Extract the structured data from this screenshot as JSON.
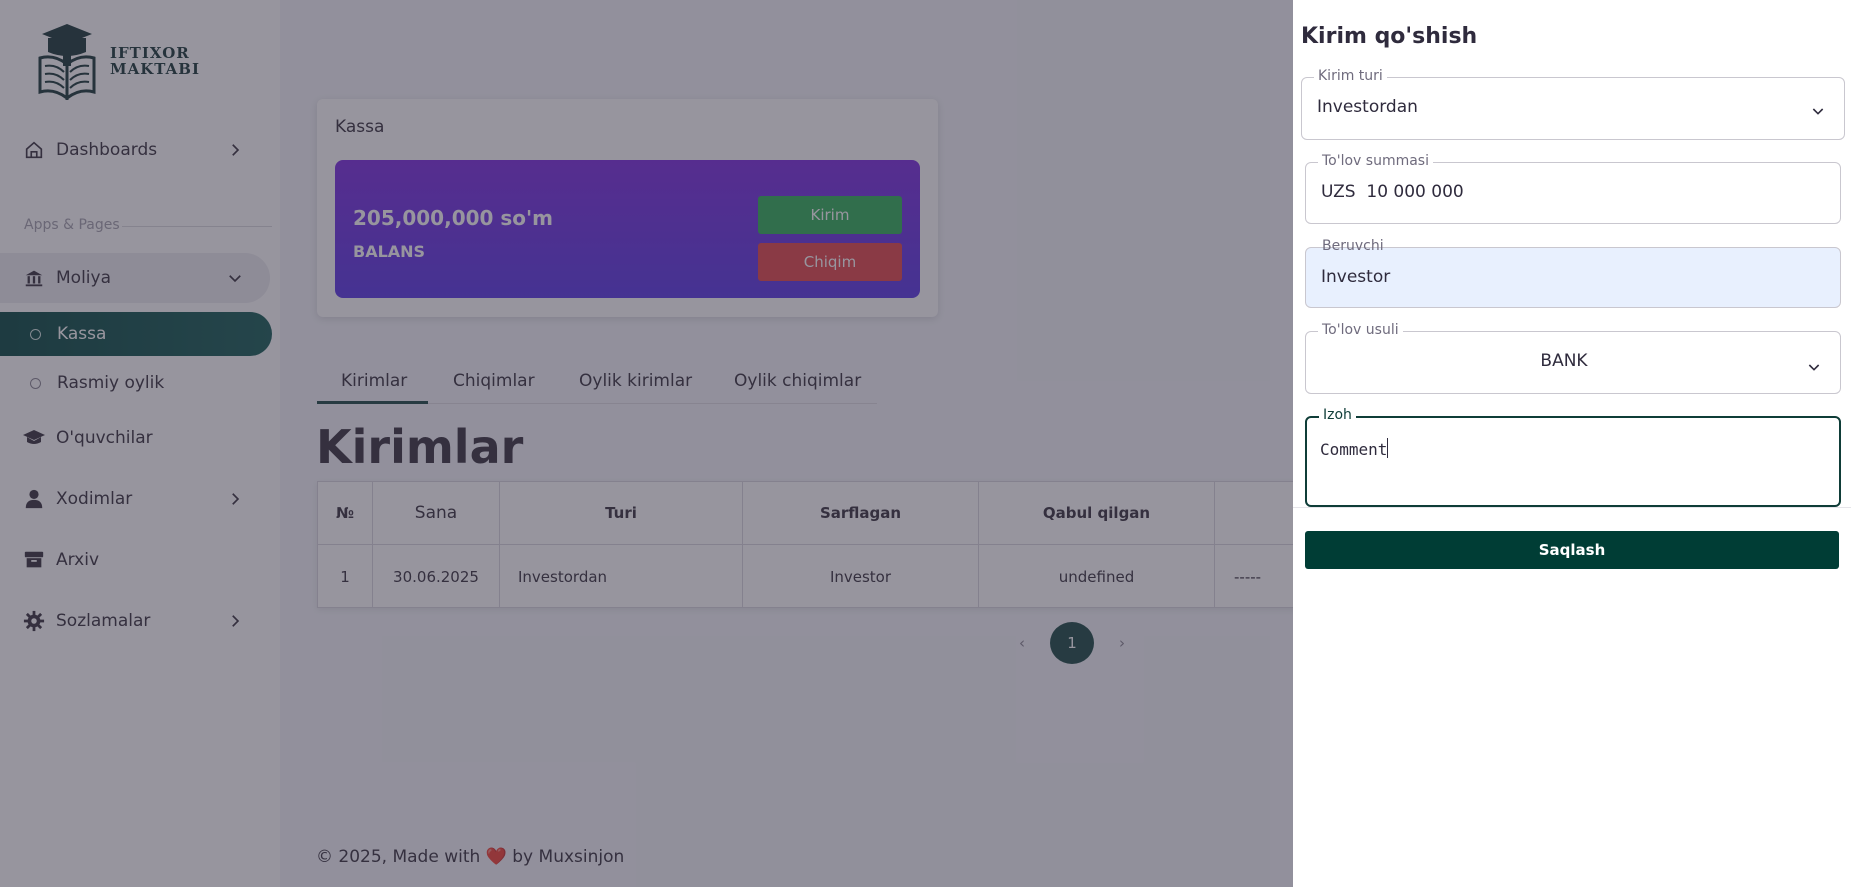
{
  "sidebar": {
    "logo_line1": "IFTIXOR",
    "logo_line2": "MAKTABI",
    "dashboards": "Dashboards",
    "section": "Apps & Pages",
    "moliya": "Moliya",
    "kassa": "Kassa",
    "rasmiy_oylik": "Rasmiy oylik",
    "oquvchilar": "O'quvchilar",
    "xodimlar": "Xodimlar",
    "arxiv": "Arxiv",
    "sozlamalar": "Sozlamalar"
  },
  "kassa_card": {
    "title": "Kassa",
    "amount": "205,000,000 so'm",
    "label": "BALANS",
    "kirim": "Kirim",
    "chiqim": "Chiqim"
  },
  "tabs": [
    "Kirimlar",
    "Chiqimlar",
    "Oylik kirimlar",
    "Oylik chiqimlar"
  ],
  "page_heading": "Kirimlar",
  "table": {
    "headers": [
      "№",
      "Sana",
      "Turi",
      "Sarflagan",
      "Qabul qilgan",
      ""
    ],
    "rows": [
      [
        "1",
        "30.06.2025",
        "Investordan",
        "Investor",
        "undefined",
        "-----"
      ]
    ]
  },
  "pagination": {
    "current": "1",
    "prev": "‹",
    "next": "›"
  },
  "footer": {
    "before": "© 2025, Made with",
    "heart": "❤️",
    "after": "by Muxsinjon"
  },
  "drawer": {
    "title": "Kirim qo'shish",
    "kirim_turi": {
      "label": "Kirim turi",
      "value": "Investordan"
    },
    "summa": {
      "label": "To'lov summasi",
      "value": "UZS  10 000 000"
    },
    "beruvchi": {
      "label": "Beruvchi",
      "value": "Investor"
    },
    "usul": {
      "label": "To'lov usuli",
      "value": "BANK"
    },
    "izoh": {
      "label": "Izoh",
      "value": "Comment"
    },
    "save": "Saqlash"
  },
  "colors": {
    "primary": "#1e4a46",
    "save_button": "#003d35",
    "kirim_button": "#33b05a",
    "chiqim_button": "#e5484d",
    "balance_gradient_top": "#7d2fe0",
    "balance_gradient_bottom": "#5b3ae6"
  }
}
